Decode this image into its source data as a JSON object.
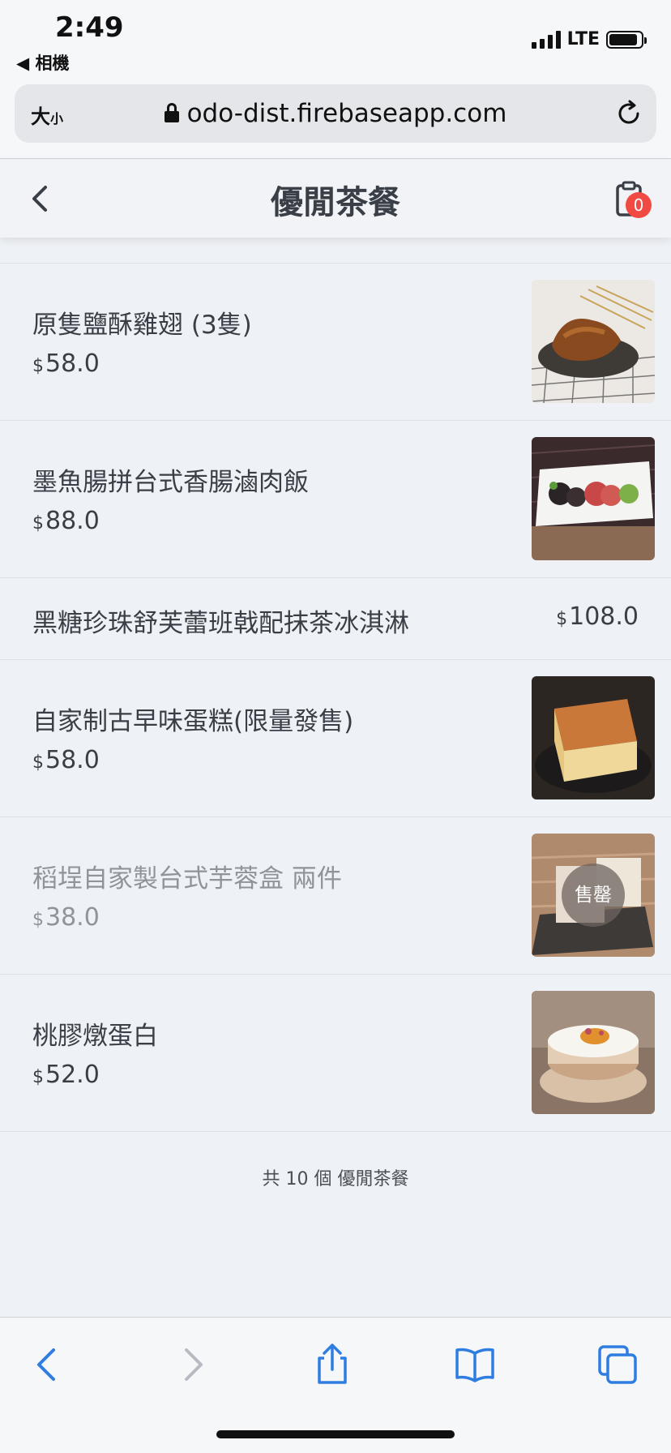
{
  "status_bar": {
    "time": "2:49",
    "back_app": "◀ 相機",
    "network": "LTE"
  },
  "url_bar": {
    "text_size_label": "大",
    "text_size_small": "小",
    "url": "odo-dist.firebaseapp.com"
  },
  "header": {
    "title": "優閒茶餐",
    "cart_count": "0"
  },
  "items": [
    {
      "name": "原隻鹽酥雞翅 (3隻)",
      "currency": "$",
      "price": "58.0",
      "has_image": true,
      "sold_out": false
    },
    {
      "name": "墨魚腸拼台式香腸滷肉飯",
      "currency": "$",
      "price": "88.0",
      "has_image": true,
      "sold_out": false
    },
    {
      "name": "黑糖珍珠舒芙蕾班戟配抹茶冰淇淋",
      "currency": "$",
      "price": "108.0",
      "has_image": false,
      "sold_out": false
    },
    {
      "name": "自家制古早味蛋糕(限量發售)",
      "currency": "$",
      "price": "58.0",
      "has_image": true,
      "sold_out": false
    },
    {
      "name": "稻埕自家製台式芋蓉盒 兩件",
      "currency": "$",
      "price": "38.0",
      "has_image": true,
      "sold_out": true,
      "sold_label": "售罄"
    },
    {
      "name": "桃膠燉蛋白",
      "currency": "$",
      "price": "52.0",
      "has_image": true,
      "sold_out": false
    }
  ],
  "footer": {
    "count_text": "共 10 個 優閒茶餐"
  },
  "colors": {
    "background": "#eef1f5",
    "badge": "#f04a43",
    "safari_blue": "#2f7de1"
  }
}
